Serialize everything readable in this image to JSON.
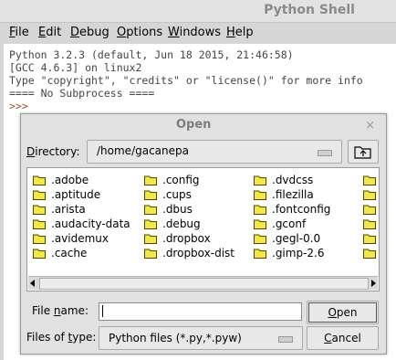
{
  "shell": {
    "title": "Python Shell",
    "menu": [
      {
        "key": "F",
        "rest": "ile"
      },
      {
        "key": "E",
        "rest": "dit"
      },
      {
        "key": "D",
        "rest": "ebug"
      },
      {
        "key": "O",
        "rest": "ptions"
      },
      {
        "key": "W",
        "rest": "indows"
      },
      {
        "key": "H",
        "rest": "elp"
      }
    ],
    "lines": [
      "Python 3.2.3 (default, Jun 18 2015, 21:46:58)",
      "[GCC 4.6.3] on linux2",
      "Type \"copyright\", \"credits\" or \"license()\" for more info",
      "==== No Subprocess ===="
    ],
    "prompt": ">>>"
  },
  "dialog": {
    "title": "Open",
    "close": "×",
    "directory_label_key": "D",
    "directory_label_rest": "irectory:",
    "directory_value": "/home/gacanepa",
    "files": [
      [
        ".adobe",
        ".aptitude",
        ".arista",
        ".audacity-data",
        ".avidemux",
        ".cache"
      ],
      [
        ".config",
        ".cups",
        ".dbus",
        ".debug",
        ".dropbox",
        ".dropbox-dist"
      ],
      [
        ".dvdcss",
        ".filezilla",
        ".fontconfig",
        ".gconf",
        ".gegl-0.0",
        ".gimp-2.6"
      ],
      [
        "",
        "",
        "",
        "",
        "",
        ""
      ]
    ],
    "filename_label_pre": "File ",
    "filename_label_key": "n",
    "filename_label_rest": "ame:",
    "filename_value": "",
    "filetype_label_pre": "Files of ",
    "filetype_label_key": "t",
    "filetype_label_rest": "ype:",
    "filetype_value": "Python files (*.py,*.pyw)",
    "open_key": "O",
    "open_rest": "pen",
    "cancel_key": "C",
    "cancel_rest": "ancel"
  },
  "colors": {
    "folder_fill": "#f5e642",
    "folder_stroke": "#4a4a00",
    "prompt": "#a24b2c"
  }
}
